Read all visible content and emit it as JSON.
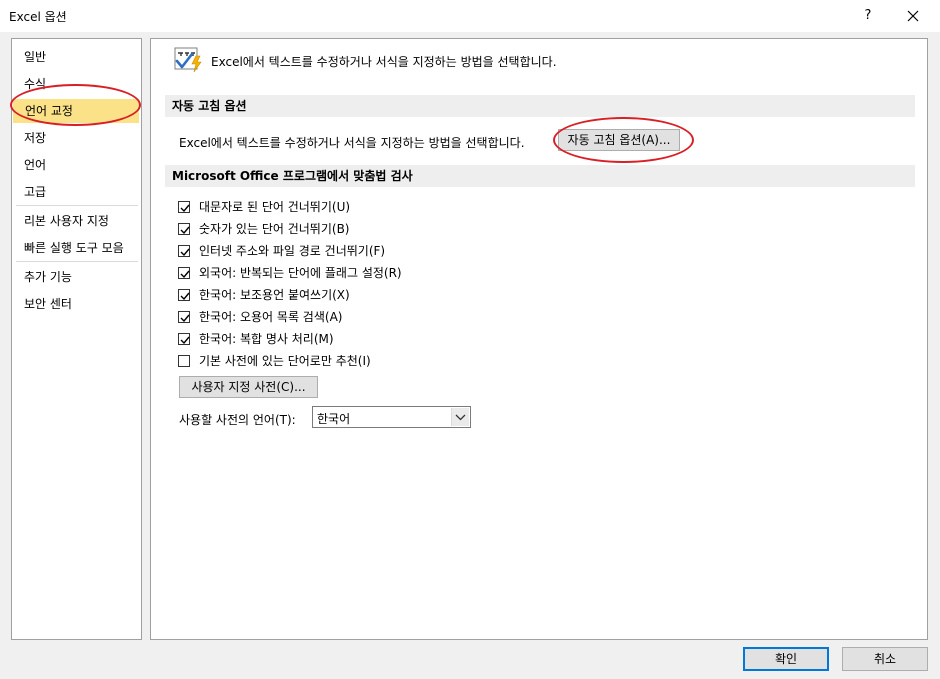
{
  "window": {
    "title": "Excel 옵션",
    "help_label": "?"
  },
  "nav": {
    "items": [
      {
        "label": "일반"
      },
      {
        "label": "수식"
      },
      {
        "label": "언어 교정"
      },
      {
        "label": "저장"
      },
      {
        "label": "언어"
      },
      {
        "label": "고급"
      },
      {
        "label": "리본 사용자 지정"
      },
      {
        "label": "빠른 실행 도구 모음"
      },
      {
        "label": "추가 기능"
      },
      {
        "label": "보안 센터"
      }
    ],
    "selected": "언어 교정"
  },
  "header": {
    "text": "Excel에서 텍스트를 수정하거나 서식을 지정하는 방법을 선택합니다.",
    "icon": "abc-check-icon"
  },
  "autocorrect": {
    "section_title": "자동 고침 옵션",
    "description": "Excel에서 텍스트를 수정하거나 서식을 지정하는 방법을 선택합니다.",
    "button_label": "자동 고침 옵션(A)..."
  },
  "spelling": {
    "section_title": "Microsoft Office 프로그램에서 맞춤법 검사",
    "options": [
      {
        "label": "대문자로 된 단어 건너뛰기(U)",
        "checked": true
      },
      {
        "label": "숫자가 있는 단어 건너뛰기(B)",
        "checked": true
      },
      {
        "label": "인터넷 주소와 파일 경로 건너뛰기(F)",
        "checked": true
      },
      {
        "label": "외국어: 반복되는 단어에 플래그 설정(R)",
        "checked": true
      },
      {
        "label": "한국어: 보조용언 붙여쓰기(X)",
        "checked": true
      },
      {
        "label": "한국어: 오용어 목록 검색(A)",
        "checked": true
      },
      {
        "label": "한국어: 복합 명사 처리(M)",
        "checked": true
      },
      {
        "label": "기본 사전에 있는 단어로만 추천(I)",
        "checked": false
      }
    ],
    "custom_dict_button": "사용자 지정 사전(C)...",
    "dict_lang_label": "사용할 사전의 언어(T):",
    "dict_lang_value": "한국어"
  },
  "footer": {
    "ok_label": "확인",
    "cancel_label": "취소"
  },
  "colors": {
    "selection": "#fbe288",
    "annotation": "#d91f26",
    "focus": "#0078d7"
  }
}
